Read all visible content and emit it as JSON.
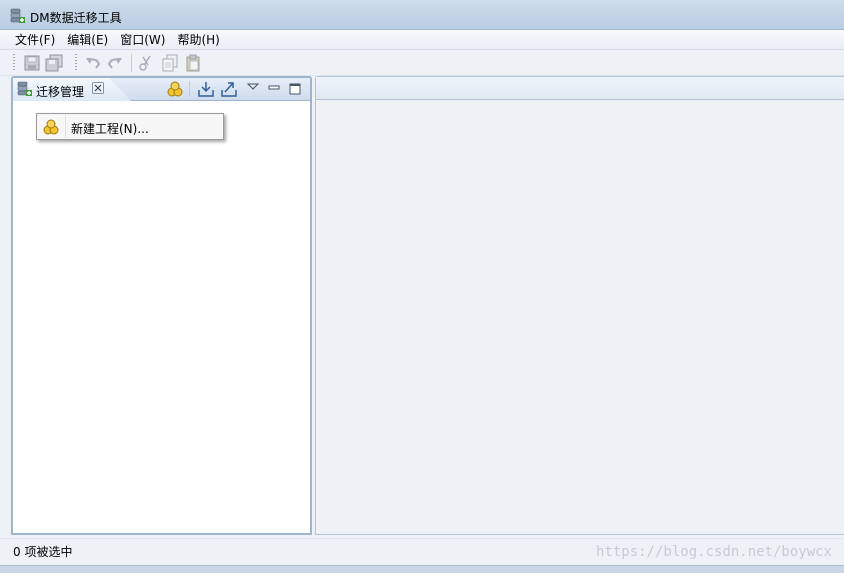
{
  "window": {
    "title": "DM数据迁移工具",
    "icon": "database-migration-icon"
  },
  "menubar": {
    "items": [
      {
        "label": "文件(F)"
      },
      {
        "label": "编辑(E)"
      },
      {
        "label": "窗口(W)"
      },
      {
        "label": "帮助(H)"
      }
    ]
  },
  "toolbar": {
    "buttons": [
      {
        "icon": "save-icon",
        "enabled": false
      },
      {
        "icon": "save-all-icon",
        "enabled": false
      },
      {
        "icon": "undo-icon",
        "enabled": false
      },
      {
        "icon": "redo-icon",
        "enabled": false
      },
      {
        "icon": "cut-icon",
        "enabled": false
      },
      {
        "icon": "copy-icon",
        "enabled": false
      },
      {
        "icon": "paste-icon",
        "enabled": false
      }
    ]
  },
  "migration_view": {
    "tab_label": "迁移管理",
    "tab_icon": "migration-manager-icon",
    "tools": [
      "new-project-icon",
      "import-icon",
      "export-icon",
      "view-menu-icon",
      "minimize-icon",
      "maximize-icon"
    ],
    "context_menu": {
      "items": [
        {
          "label": "新建工程(N)...",
          "icon": "new-project-icon"
        }
      ]
    }
  },
  "statusbar": {
    "text": "0 项被选中",
    "watermark": "https://blog.csdn.net/boywcx"
  },
  "colors": {
    "titlebar": "#c5d5e6",
    "workspace": "#eef2f7",
    "view_border": "#9eb4cd"
  }
}
